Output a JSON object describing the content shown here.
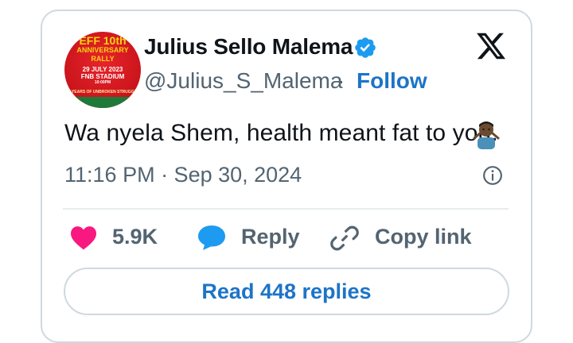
{
  "tweet": {
    "author": {
      "display_name": "Julius Sello Malema",
      "handle": "@Julius_S_Malema",
      "verified": true,
      "avatar": {
        "line1": "EFF 10th",
        "line2": "ANNIVERSARY",
        "line3": "RALLY",
        "line4": "29 JULY 2023",
        "line5": "FNB STADIUM",
        "line6": "10:00PM",
        "line7": "10 YEARS OF UNBROKEN STRUGGLE"
      }
    },
    "follow_label": "Follow",
    "separator": "·",
    "text": "Wa nyela Shem, health meant fat to you.",
    "emoji": "person-shrugging-emoji",
    "timestamp": "11:16 PM · Sep 30, 2024",
    "likes_count": "5.9K",
    "reply_label": "Reply",
    "copy_link_label": "Copy link",
    "read_replies_label": "Read 448 replies"
  },
  "icons": {
    "verified": "verified-badge-icon",
    "platform": "x-logo-icon",
    "info": "info-icon",
    "like": "heart-icon",
    "reply": "reply-bubble-icon",
    "link": "link-icon"
  },
  "colors": {
    "accent": "#1d74c8",
    "verified": "#1d9bf0",
    "heart": "#f91880",
    "muted_text": "#536471",
    "border": "#cfd9de"
  }
}
